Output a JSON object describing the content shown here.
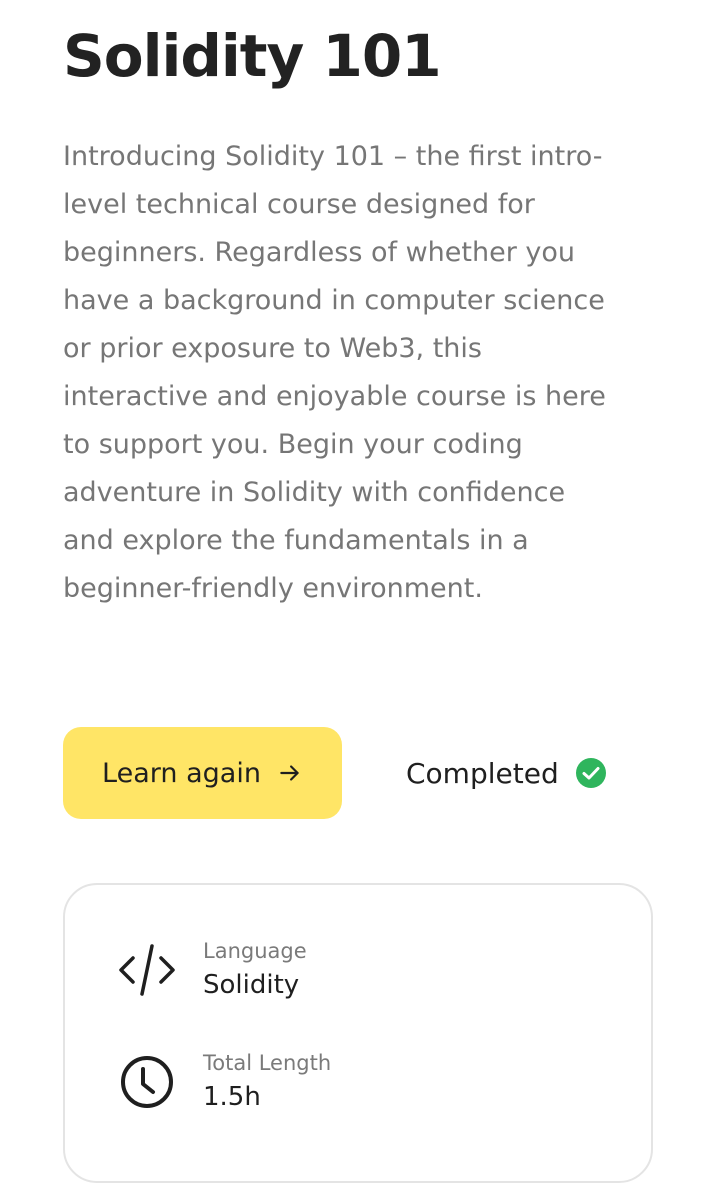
{
  "course": {
    "title": "Solidity 101",
    "description": "Introducing Solidity 101 – the first intro-level technical course designed for beginners. Regardless of whether you have a background in computer science or prior exposure to Web3, this interactive and enjoyable course is here to support you. Begin your coding adventure in Solidity with confidence and explore the fundamentals in a beginner-friendly environment."
  },
  "actions": {
    "learn_label": "Learn again",
    "learn_icon": "arrow-right-icon",
    "status_label": "Completed",
    "status_icon": "check-circle-icon"
  },
  "details": {
    "language_label": "Language",
    "language_value": "Solidity",
    "language_icon": "code-icon",
    "length_label": "Total Length",
    "length_value": "1.5h",
    "length_icon": "clock-icon"
  },
  "colors": {
    "button_bg": "#ffe566",
    "success": "#2fb55d",
    "text_muted": "#767676",
    "card_border": "#e4e4e4"
  }
}
